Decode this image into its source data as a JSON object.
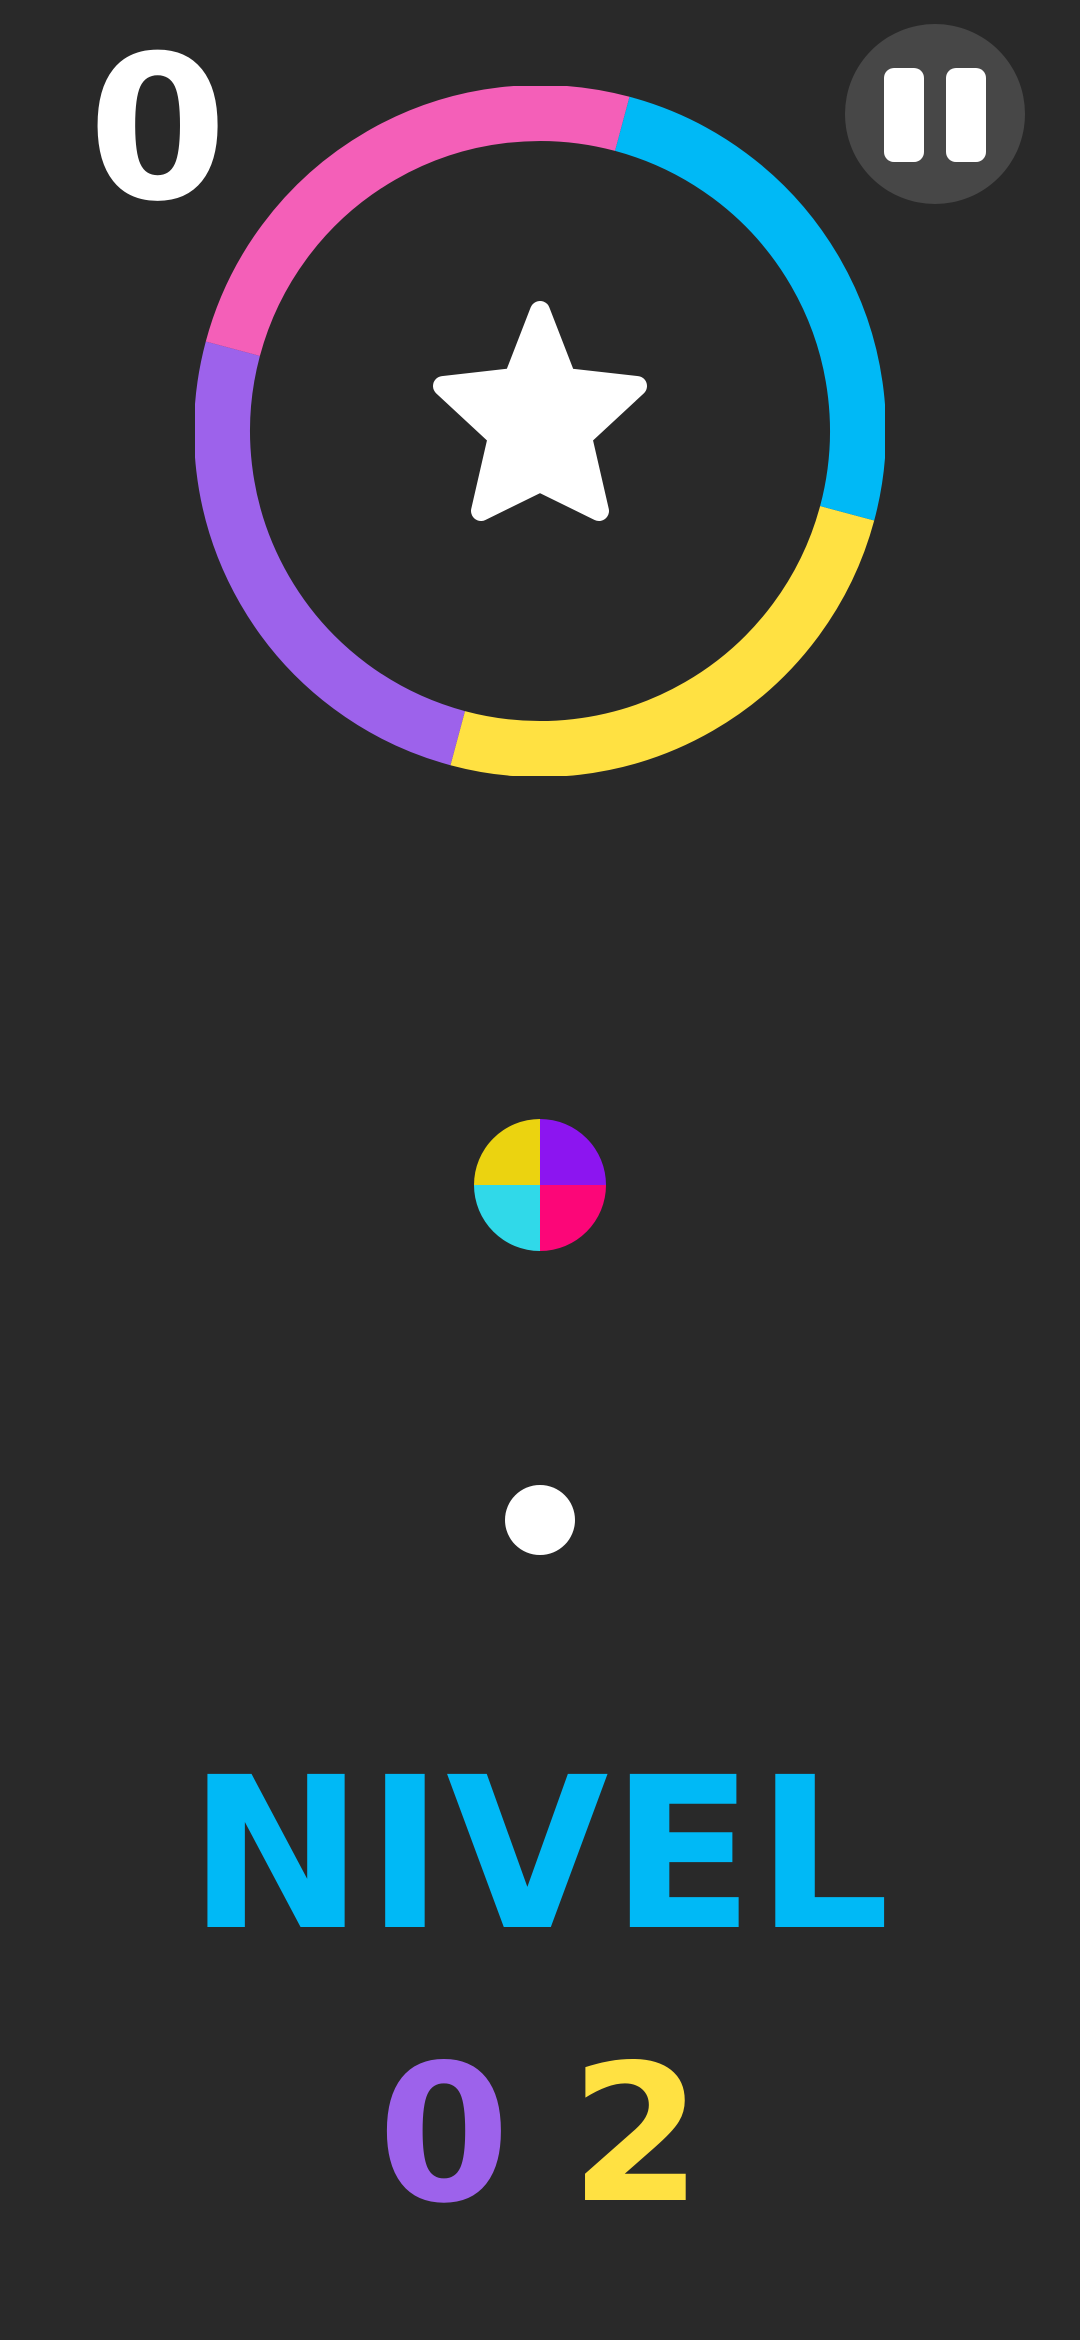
{
  "hud": {
    "score": "0"
  },
  "ring": {
    "colors": [
      "#ffe142",
      "#9d62eb",
      "#f45fb8",
      "#00b9f6"
    ]
  },
  "switcher": {
    "colors": [
      "#ebd310",
      "#8c15f0",
      "#fc0678",
      "#30d9e9"
    ]
  },
  "ball": {
    "color": "#ffffff"
  },
  "level": {
    "label": "NIVEL",
    "label_color": "#00b9f6",
    "digit_1": "0",
    "digit_1_color": "#9d62eb",
    "digit_2": "2",
    "digit_2_color": "#ffe142"
  }
}
